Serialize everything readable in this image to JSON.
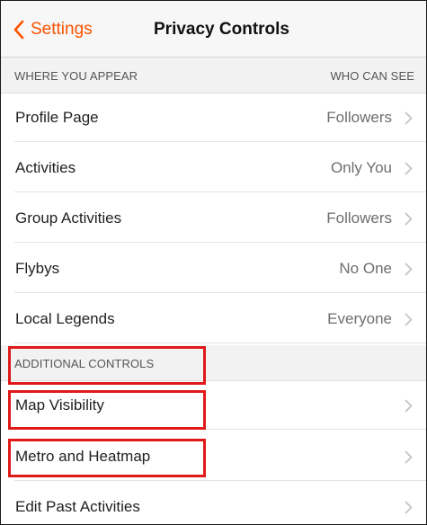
{
  "nav": {
    "back_label": "Settings",
    "title": "Privacy Controls"
  },
  "sections": {
    "where": {
      "header_left": "WHERE YOU APPEAR",
      "header_right": "WHO CAN SEE",
      "rows": [
        {
          "label": "Profile Page",
          "value": "Followers"
        },
        {
          "label": "Activities",
          "value": "Only You"
        },
        {
          "label": "Group Activities",
          "value": "Followers"
        },
        {
          "label": "Flybys",
          "value": "No One"
        },
        {
          "label": "Local Legends",
          "value": "Everyone"
        }
      ]
    },
    "additional": {
      "header_left": "ADDITIONAL CONTROLS",
      "rows": [
        {
          "label": "Map Visibility"
        },
        {
          "label": "Metro and Heatmap"
        },
        {
          "label": "Edit Past Activities"
        }
      ]
    }
  },
  "colors": {
    "accent": "#fc5200",
    "highlight": "#e01919"
  },
  "icons": {
    "back": "chevron-left-icon",
    "row": "chevron-right-icon"
  }
}
